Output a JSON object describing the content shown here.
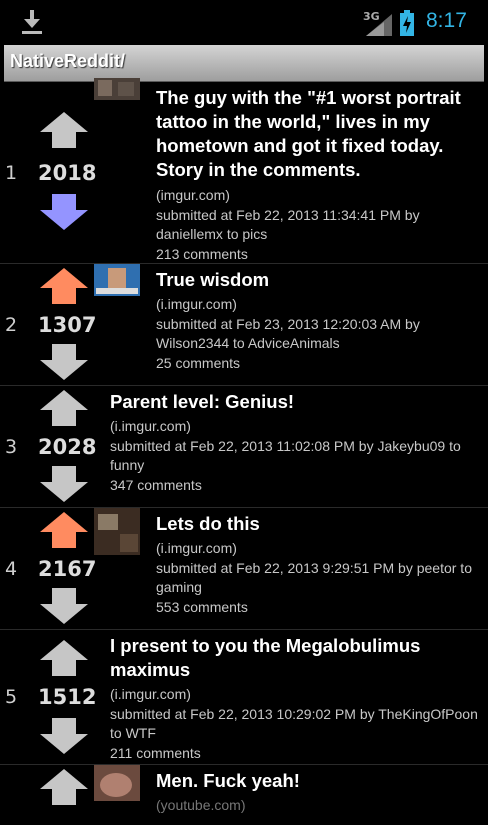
{
  "status_bar": {
    "network": "3G",
    "time": "8:17",
    "clock_color": "#33b5e5"
  },
  "app": {
    "title": "NativeReddit/"
  },
  "colors": {
    "upvote_active": "#ff8b60",
    "downvote_active": "#9494ff",
    "arrow_inactive": "#c6c6c6"
  },
  "posts": [
    {
      "rank": "1",
      "score": "2018",
      "vote": "down",
      "title": "The guy with the \"#1 worst portrait tattoo in the world,\" lives in my hometown and got it fixed today. Story in the comments.",
      "domain": "(imgur.com)",
      "submitted": "submitted at Feb 22, 2013 11:34:41 PM by daniellemx to pics",
      "comments": "213 comments",
      "has_thumb": true
    },
    {
      "rank": "2",
      "score": "1307",
      "vote": "up",
      "title": "True wisdom",
      "domain": "(i.imgur.com)",
      "submitted": "submitted at Feb 23, 2013 12:20:03 AM by Wilson2344 to AdviceAnimals",
      "comments": "25 comments",
      "has_thumb": true
    },
    {
      "rank": "3",
      "score": "2028",
      "vote": "none",
      "title": "Parent level: Genius!",
      "domain": "(i.imgur.com)",
      "submitted": "submitted at Feb 22, 2013 11:02:08 PM by Jakeybu09 to funny",
      "comments": "347 comments",
      "has_thumb": false
    },
    {
      "rank": "4",
      "score": "2167",
      "vote": "up",
      "title": "Lets do this",
      "domain": "(i.imgur.com)",
      "submitted": "submitted at Feb 22, 2013 9:29:51 PM by peetor to gaming",
      "comments": "553 comments",
      "has_thumb": true
    },
    {
      "rank": "5",
      "score": "1512",
      "vote": "none",
      "title": "I present to you the Megalobulimus maximus",
      "domain": "(i.imgur.com)",
      "submitted": "submitted at Feb 22, 2013 10:29:02 PM by TheKingOfPoon to WTF",
      "comments": "211 comments",
      "has_thumb": false
    },
    {
      "rank": "",
      "score": "",
      "vote": "none",
      "title": "Men. Fuck yeah!",
      "domain": "(youtube.com)",
      "submitted": "",
      "comments": "",
      "has_thumb": true
    }
  ]
}
